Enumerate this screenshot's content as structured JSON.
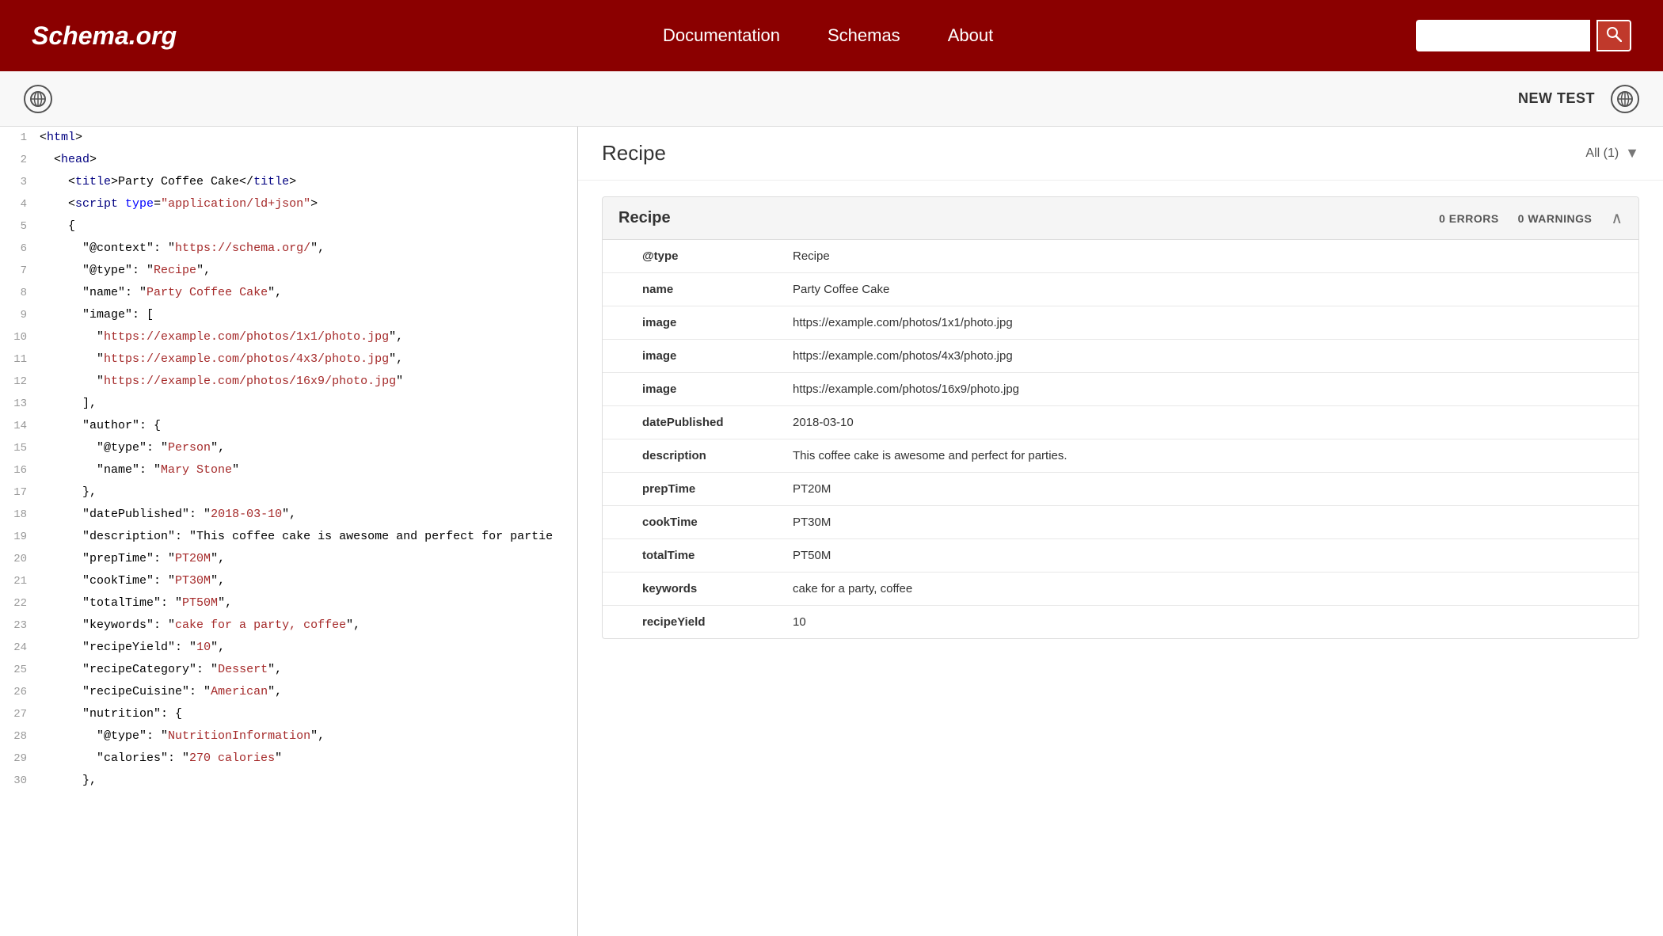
{
  "header": {
    "logo": "Schema.org",
    "nav": {
      "documentation": "Documentation",
      "schemas": "Schemas",
      "about": "About"
    },
    "search": {
      "placeholder": "",
      "button_label": "Search"
    }
  },
  "toolbar": {
    "new_test_label": "NEW TEST"
  },
  "results": {
    "title": "Recipe",
    "filter": "All (1)",
    "card": {
      "title": "Recipe",
      "errors": "0 ERRORS",
      "warnings": "0 WARNINGS",
      "fields": [
        {
          "key": "@type",
          "value": "Recipe"
        },
        {
          "key": "name",
          "value": "Party Coffee Cake"
        },
        {
          "key": "image",
          "value": "https://example.com/photos/1x1/photo.jpg"
        },
        {
          "key": "image",
          "value": "https://example.com/photos/4x3/photo.jpg"
        },
        {
          "key": "image",
          "value": "https://example.com/photos/16x9/photo.jpg"
        },
        {
          "key": "datePublished",
          "value": "2018-03-10"
        },
        {
          "key": "description",
          "value": "This coffee cake is awesome and perfect for parties."
        },
        {
          "key": "prepTime",
          "value": "PT20M"
        },
        {
          "key": "cookTime",
          "value": "PT30M"
        },
        {
          "key": "totalTime",
          "value": "PT50M"
        },
        {
          "key": "keywords",
          "value": "cake for a party, coffee"
        },
        {
          "key": "recipeYield",
          "value": "10"
        }
      ]
    }
  },
  "code": {
    "lines": [
      {
        "num": 1,
        "content": "<html>"
      },
      {
        "num": 2,
        "content": "  <head>"
      },
      {
        "num": 3,
        "content": "    <title>Party Coffee Cake</title>"
      },
      {
        "num": 4,
        "content": "    <script type=\"application/ld+json\">"
      },
      {
        "num": 5,
        "content": "    {"
      },
      {
        "num": 6,
        "content": "      \"@context\": \"https://schema.org/\","
      },
      {
        "num": 7,
        "content": "      \"@type\": \"Recipe\","
      },
      {
        "num": 8,
        "content": "      \"name\": \"Party Coffee Cake\","
      },
      {
        "num": 9,
        "content": "      \"image\": ["
      },
      {
        "num": 10,
        "content": "        \"https://example.com/photos/1x1/photo.jpg\","
      },
      {
        "num": 11,
        "content": "        \"https://example.com/photos/4x3/photo.jpg\","
      },
      {
        "num": 12,
        "content": "        \"https://example.com/photos/16x9/photo.jpg\""
      },
      {
        "num": 13,
        "content": "      ],"
      },
      {
        "num": 14,
        "content": "      \"author\": {"
      },
      {
        "num": 15,
        "content": "        \"@type\": \"Person\","
      },
      {
        "num": 16,
        "content": "        \"name\": \"Mary Stone\""
      },
      {
        "num": 17,
        "content": "      },"
      },
      {
        "num": 18,
        "content": "      \"datePublished\": \"2018-03-10\","
      },
      {
        "num": 19,
        "content": "      \"description\": \"This coffee cake is awesome and perfect for partie"
      },
      {
        "num": 20,
        "content": "      \"prepTime\": \"PT20M\","
      },
      {
        "num": 21,
        "content": "      \"cookTime\": \"PT30M\","
      },
      {
        "num": 22,
        "content": "      \"totalTime\": \"PT50M\","
      },
      {
        "num": 23,
        "content": "      \"keywords\": \"cake for a party, coffee\","
      },
      {
        "num": 24,
        "content": "      \"recipeYield\": \"10\","
      },
      {
        "num": 25,
        "content": "      \"recipeCategory\": \"Dessert\","
      },
      {
        "num": 26,
        "content": "      \"recipeCuisine\": \"American\","
      },
      {
        "num": 27,
        "content": "      \"nutrition\": {"
      },
      {
        "num": 28,
        "content": "        \"@type\": \"NutritionInformation\","
      },
      {
        "num": 29,
        "content": "        \"calories\": \"270 calories\""
      },
      {
        "num": 30,
        "content": "      },"
      }
    ]
  }
}
